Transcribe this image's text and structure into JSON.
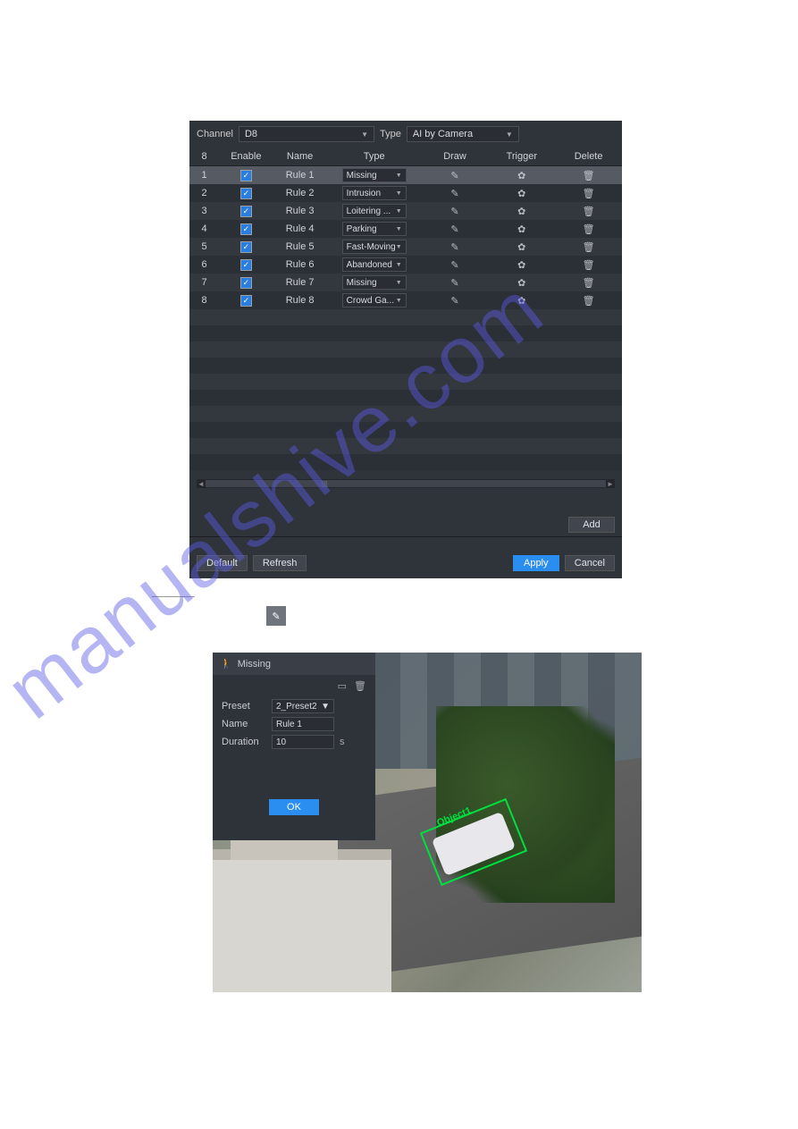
{
  "top": {
    "channel_label": "Channel",
    "channel_value": "D8",
    "type_label": "Type",
    "type_value": "AI by Camera"
  },
  "columns": {
    "idx": "8",
    "enable": "Enable",
    "name": "Name",
    "type": "Type",
    "draw": "Draw",
    "trigger": "Trigger",
    "delete": "Delete"
  },
  "rules": [
    {
      "idx": "1",
      "name": "Rule 1",
      "type": "Missing"
    },
    {
      "idx": "2",
      "name": "Rule 2",
      "type": "Intrusion"
    },
    {
      "idx": "3",
      "name": "Rule 3",
      "type": "Loitering ..."
    },
    {
      "idx": "4",
      "name": "Rule 4",
      "type": "Parking"
    },
    {
      "idx": "5",
      "name": "Rule 5",
      "type": "Fast-Moving"
    },
    {
      "idx": "6",
      "name": "Rule 6",
      "type": "Abandoned"
    },
    {
      "idx": "7",
      "name": "Rule 7",
      "type": "Missing"
    },
    {
      "idx": "8",
      "name": "Rule 8",
      "type": "Crowd Ga..."
    }
  ],
  "buttons": {
    "add": "Add",
    "default": "Default",
    "refresh": "Refresh",
    "apply": "Apply",
    "cancel": "Cancel"
  },
  "overlay": {
    "title": "Missing",
    "preset_label": "Preset",
    "preset_value": "2_Preset2",
    "name_label": "Name",
    "name_value": "Rule 1",
    "duration_label": "Duration",
    "duration_value": "10",
    "duration_unit": "s",
    "ok": "OK"
  },
  "detection": {
    "label": "Object1"
  },
  "watermark": "manualshive.com"
}
